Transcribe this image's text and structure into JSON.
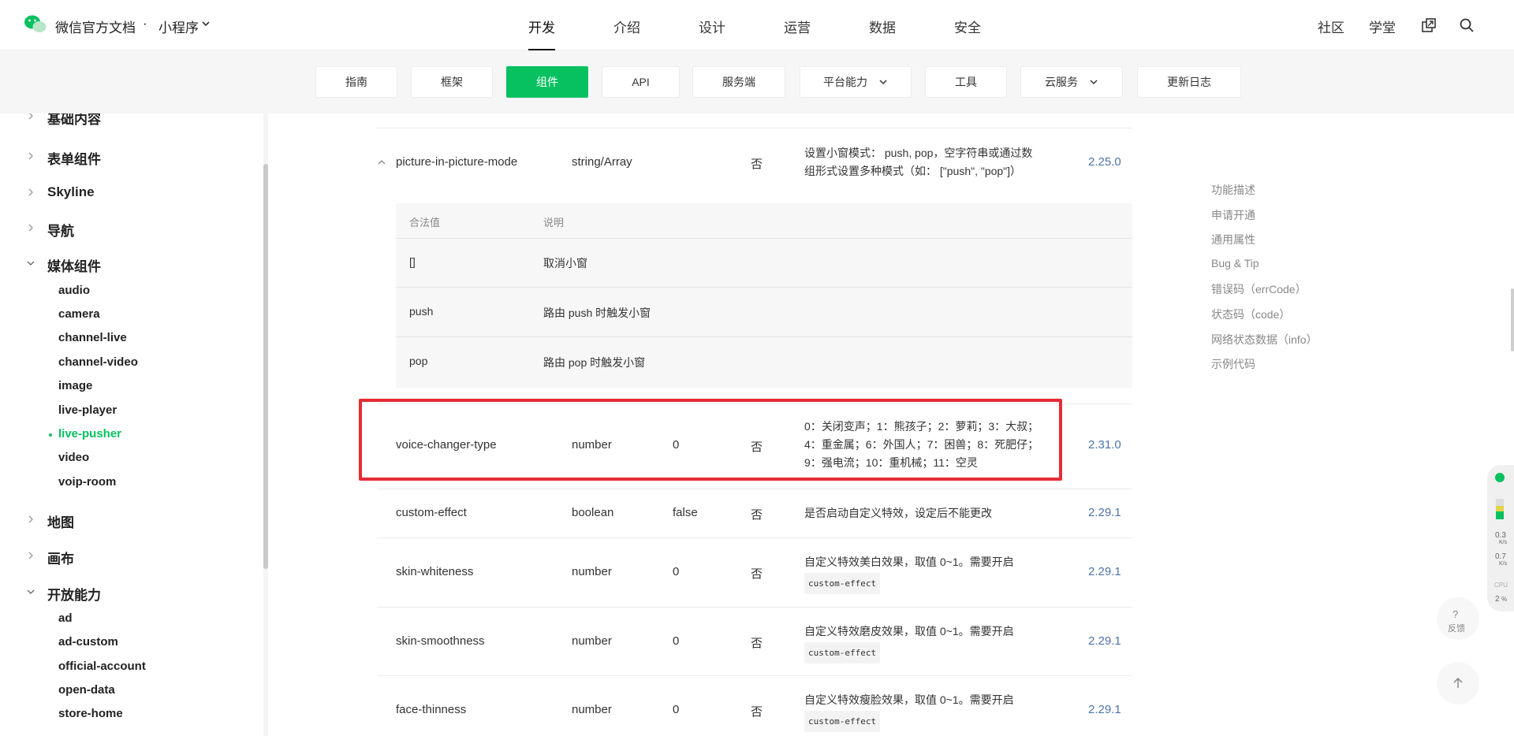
{
  "header": {
    "site_title": "微信官方文档",
    "separator": "·",
    "section": "小程序",
    "nav": [
      "开发",
      "介绍",
      "设计",
      "运营",
      "数据",
      "安全"
    ],
    "active_nav": "开发",
    "right_links": [
      "社区",
      "学堂"
    ],
    "icons": [
      "wechat-logo-icon",
      "chevron-down-icon",
      "external-link-icon",
      "search-icon"
    ],
    "accent_color": "#07c160"
  },
  "subnav": {
    "items": [
      {
        "label": "指南"
      },
      {
        "label": "框架"
      },
      {
        "label": "组件"
      },
      {
        "label": "API"
      },
      {
        "label": "服务端"
      },
      {
        "label": "平台能力"
      },
      {
        "label": "工具"
      },
      {
        "label": "云服务"
      },
      {
        "label": "更新日志"
      }
    ],
    "active": "组件"
  },
  "sidebar": {
    "groups": [
      {
        "label": "基础内容",
        "expanded": false
      },
      {
        "label": "表单组件",
        "expanded": false
      },
      {
        "label": "Skyline",
        "expanded": false
      },
      {
        "label": "导航",
        "expanded": false
      },
      {
        "label": "媒体组件",
        "expanded": true
      },
      {
        "label": "地图",
        "expanded": false
      },
      {
        "label": "画布",
        "expanded": false
      },
      {
        "label": "开放能力",
        "expanded": true
      }
    ],
    "media_items": [
      "audio",
      "camera",
      "channel-live",
      "channel-video",
      "image",
      "live-player",
      "live-pusher",
      "video",
      "voip-room"
    ],
    "open_items": [
      "ad",
      "ad-custom",
      "official-account",
      "open-data",
      "store-home"
    ],
    "active_item": "live-pusher"
  },
  "table": {
    "pip_row": {
      "name": "picture-in-picture-mode",
      "type": "string/Array",
      "default": "",
      "required": "否",
      "desc": "设置小窗模式： push, pop，空字符串或通过数组形式设置多种模式（如： [\"push\", \"pop\"]）",
      "version": "2.25.0"
    },
    "pip_subtable": {
      "headers": [
        "合法值",
        "说明"
      ],
      "rows": [
        {
          "value": "[]",
          "desc": "取消小窗"
        },
        {
          "value": "push",
          "desc": "路由 push 时触发小窗"
        },
        {
          "value": "pop",
          "desc": "路由 pop 时触发小窗"
        }
      ]
    },
    "voice_row": {
      "name": "voice-changer-type",
      "type": "number",
      "default": "0",
      "required": "否",
      "desc": "0：关闭变声；1：熊孩子；2：萝莉；3：大叔；4：重金属；6：外国人；7：困兽；8：死肥仔；9：强电流；10：重机械；11：空灵",
      "version": "2.31.0"
    },
    "custom_row": {
      "name": "custom-effect",
      "type": "boolean",
      "default": "false",
      "required": "否",
      "desc": "是否启动自定义特效，设定后不能更改",
      "version": "2.29.1"
    },
    "whiteness_row": {
      "name": "skin-whiteness",
      "type": "number",
      "default": "0",
      "required": "否",
      "desc": "自定义特效美白效果，取值 0~1。需要开启",
      "code": "custom-effect",
      "version": "2.29.1"
    },
    "smooth_row": {
      "name": "skin-smoothness",
      "type": "number",
      "default": "0",
      "required": "否",
      "desc": "自定义特效磨皮效果，取值 0~1。需要开启",
      "code": "custom-effect",
      "version": "2.29.1"
    },
    "thin_row": {
      "name": "face-thinness",
      "type": "number",
      "default": "0",
      "required": "否",
      "desc": "自定义特效瘦脸效果，取值 0~1。需要开启",
      "code": "custom-effect",
      "version": "2.29.1"
    }
  },
  "toc": [
    "功能描述",
    "申请开通",
    "通用属性",
    "Bug & Tip",
    "错误码（errCode）",
    "状态码（code）",
    "网络状态数据（info）",
    "示例代码"
  ],
  "widgets": {
    "net_up": "0.3",
    "net_up_unit": "K/s",
    "net_down": "0.7",
    "net_down_unit": "K/s",
    "cpu_label": "CPU",
    "cpu_value": "2",
    "cpu_unit": "%",
    "feedback_q": "?",
    "feedback_label": "反馈"
  }
}
